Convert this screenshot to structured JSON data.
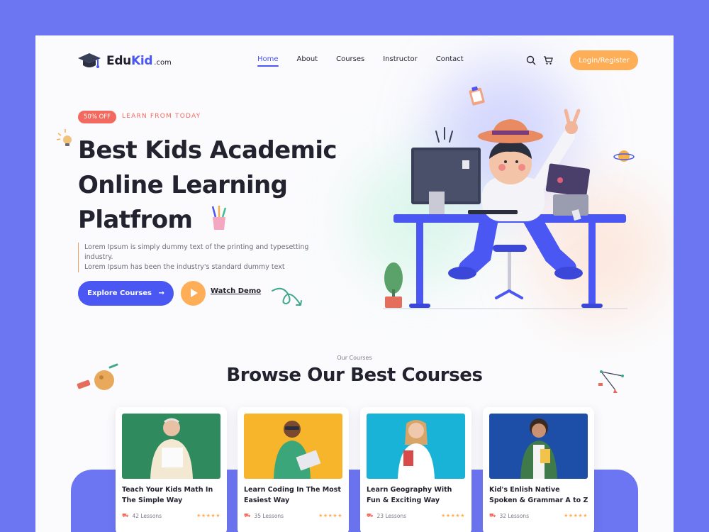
{
  "header": {
    "logo_brand": "Edu",
    "logo_accent": "Kid",
    "logo_tld": ".com",
    "nav": [
      "Home",
      "About",
      "Courses",
      "Instructor",
      "Contact"
    ],
    "active_nav": "Home",
    "login_label": "Login/Register"
  },
  "hero": {
    "badge": "50% OFF",
    "tagline": "LEARN FROM TODAY",
    "title_line1": "Best Kids Academic",
    "title_line2": "Online Learning",
    "title_line3": "Platfrom",
    "desc_line1": "Lorem Ipsum is simply dummy text of the printing and typesetting industry.",
    "desc_line2": "Lorem Ipsum has been the industry's standard dummy text",
    "explore_label": "Explore Courses",
    "watch_label": "Watch Demo"
  },
  "courses": {
    "eyebrow": "Our Courses",
    "title": "Browse Our Best Courses",
    "items": [
      {
        "title": "Teach Your Kids Math In The Simple Way",
        "lessons": "42 Lessons",
        "rating": "★★★★★"
      },
      {
        "title": "Learn Coding In The Most Easiest Way",
        "lessons": "35 Lessons",
        "rating": "★★★★★"
      },
      {
        "title": "Learn Geography With Fun & Exciting Way",
        "lessons": "23 Lessons",
        "rating": "★★★★★"
      },
      {
        "title": "Kid's Enlish Native Spoken & Grammar A to Z",
        "lessons": "32 Lessons",
        "rating": "★★★★★"
      }
    ]
  },
  "colors": {
    "primary": "#4a57f3",
    "accent": "#ffae58",
    "badge": "#f26a5f",
    "page_bg": "#6d76f2"
  }
}
